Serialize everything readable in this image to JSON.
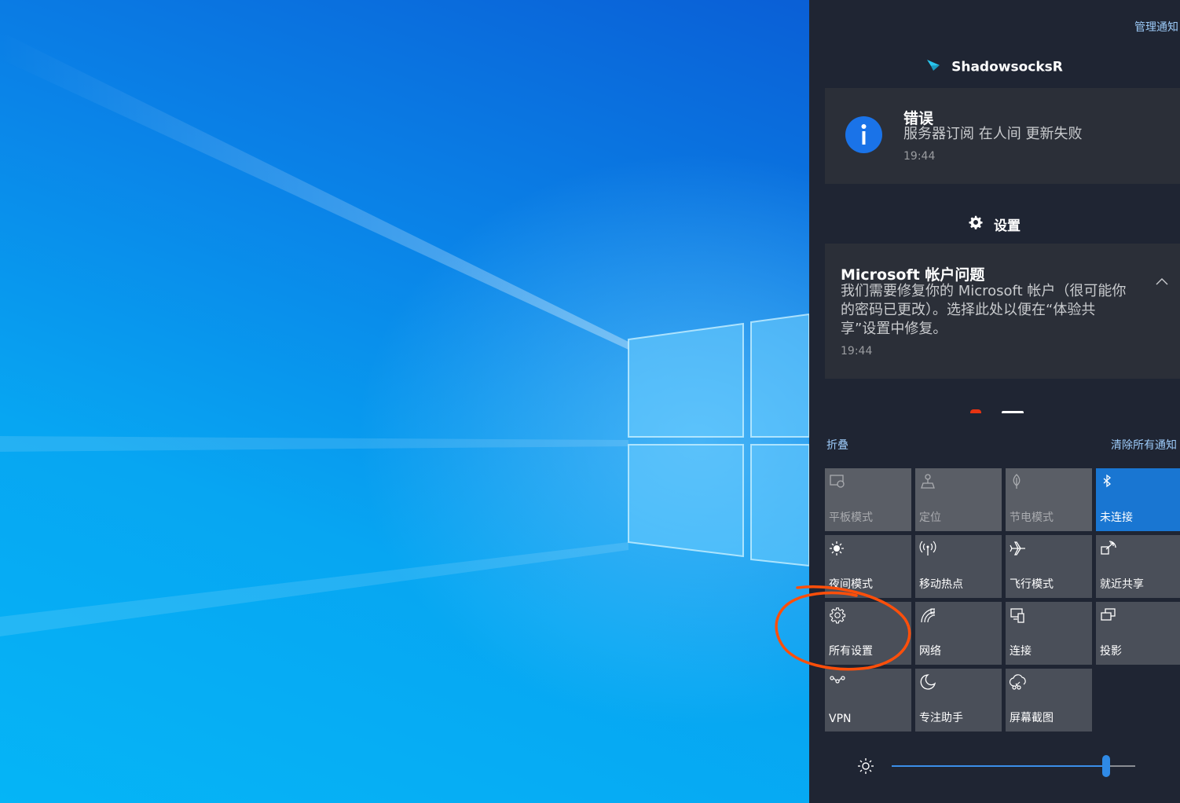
{
  "action_center": {
    "manage_notifications": "管理通知",
    "groups": [
      {
        "app_name": "ShadowsocksR",
        "icon": "paper-plane-icon",
        "notifications": [
          {
            "title": "错误",
            "body": "服务器订阅 在人间 更新失败",
            "time": "19:44",
            "icon": "info-icon"
          }
        ]
      },
      {
        "app_name": "设置",
        "icon": "gear-icon",
        "notifications": [
          {
            "title": "Microsoft 帐户问题",
            "body_lines": [
              "我们需要修复你的 Microsoft 帐户（很可能你",
              "的密码已更改）。选择此处以便在“体验共",
              "享”设置中修复。"
            ],
            "time": "19:44"
          }
        ]
      }
    ],
    "collapse_label": "折叠",
    "clear_all_label": "清除所有通知",
    "quick_actions": [
      {
        "label": "平板模式",
        "icon": "tablet-mode-icon",
        "state": "disabled"
      },
      {
        "label": "定位",
        "icon": "location-icon",
        "state": "disabled"
      },
      {
        "label": "节电模式",
        "icon": "battery-saver-icon",
        "state": "disabled"
      },
      {
        "label": "未连接",
        "icon": "bluetooth-icon",
        "state": "on"
      },
      {
        "label": "夜间模式",
        "icon": "night-light-icon",
        "state": "off"
      },
      {
        "label": "移动热点",
        "icon": "mobile-hotspot-icon",
        "state": "off"
      },
      {
        "label": "飞行模式",
        "icon": "airplane-icon",
        "state": "off"
      },
      {
        "label": "就近共享",
        "icon": "nearby-sharing-icon",
        "state": "off"
      },
      {
        "label": "所有设置",
        "icon": "gear-icon",
        "state": "off"
      },
      {
        "label": "网络",
        "icon": "network-icon",
        "state": "off"
      },
      {
        "label": "连接",
        "icon": "connect-icon",
        "state": "off"
      },
      {
        "label": "投影",
        "icon": "project-icon",
        "state": "off"
      },
      {
        "label": "VPN",
        "icon": "vpn-icon",
        "state": "off"
      },
      {
        "label": "专注助手",
        "icon": "focus-assist-icon",
        "state": "off"
      },
      {
        "label": "屏幕截图",
        "icon": "screen-snip-icon",
        "state": "off"
      }
    ],
    "brightness": {
      "icon": "brightness-icon",
      "level": 0.88
    }
  },
  "annotation": {
    "shape": "hand-drawn circle",
    "color": "#ff4f0a",
    "target": "所有设置"
  },
  "colors": {
    "panel_bg": "#1f2533",
    "tile_bg": "#4a4f59",
    "tile_active": "#1976d2",
    "link": "#9ccaf8",
    "info_blue": "#1a73e8"
  }
}
